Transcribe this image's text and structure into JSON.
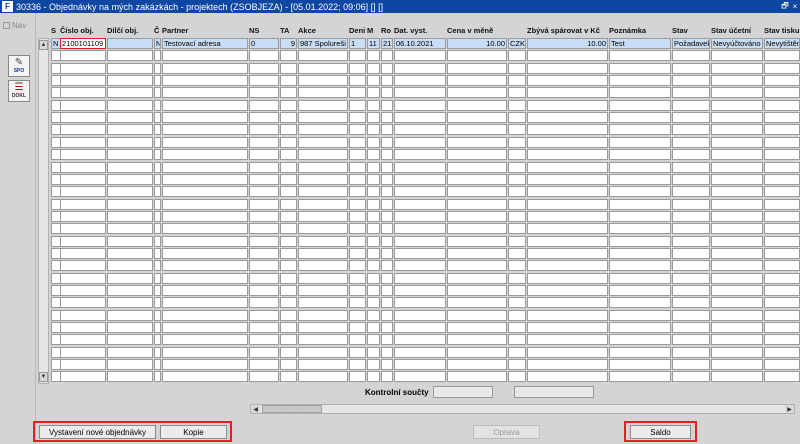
{
  "window": {
    "app_icon": "F",
    "title": "30336 - Objednávky na mých zakázkách - projektech (ZSOBJEZA) - [05.01.2022; 09:06] [] []",
    "restore_glyph": "🗗",
    "close_glyph": "×"
  },
  "sidebar": {
    "nav_label": "Nav",
    "spo_label": "SPO",
    "dokl_label": "DOKL"
  },
  "columns": [
    {
      "key": "s",
      "label": "S"
    },
    {
      "key": "cislo",
      "label": "Číslo obj."
    },
    {
      "key": "dilci",
      "label": "Dílčí obj."
    },
    {
      "key": "c",
      "label": "Č"
    },
    {
      "key": "partner",
      "label": "Partner"
    },
    {
      "key": "ns",
      "label": "NS"
    },
    {
      "key": "ta",
      "label": "TA"
    },
    {
      "key": "akce",
      "label": "Akce"
    },
    {
      "key": "den",
      "label": "Deni"
    },
    {
      "key": "m",
      "label": "M"
    },
    {
      "key": "ro",
      "label": "Ro"
    },
    {
      "key": "dat",
      "label": "Dat. vyst."
    },
    {
      "key": "cena",
      "label": "Cena v měně"
    },
    {
      "key": "mena",
      "label": ""
    },
    {
      "key": "zbyva",
      "label": "Zbývá spárovat v Kč"
    },
    {
      "key": "poznamka",
      "label": "Poznámka"
    },
    {
      "key": "stav",
      "label": "Stav"
    },
    {
      "key": "stav_ucetni",
      "label": "Stav účetní"
    },
    {
      "key": "stav_tisku",
      "label": "Stav tisku"
    }
  ],
  "rows": [
    {
      "s": "N",
      "cislo": "2100101109",
      "dilci": "",
      "c": "N",
      "partner": "Testovací adresa",
      "ns": "0",
      "ta": "9",
      "akce": "987 Spolureši",
      "den": "1",
      "m": "11",
      "ro": "21",
      "dat": "06.10.2021",
      "cena": "10.00",
      "mena": "CZK",
      "zbyva": "10.00",
      "poznamka": "Test",
      "stav": "Požadavek",
      "stav_ucetni": "Nevyúčtováno",
      "stav_tisku": "Nevytištěno"
    }
  ],
  "empty_row_count": 27,
  "footer": {
    "control_sums_label": "Kontrolní součty"
  },
  "buttons": {
    "new_order": "Vystavení nové objednávky",
    "copy": "Kopie",
    "edit": "Oprava",
    "saldo": "Saldo"
  },
  "colors": {
    "title_bar": "#0d47a1",
    "selected_row": "#c9ddf6",
    "highlight_frame": "#e21f26"
  },
  "icons": {
    "scroll_up": "▲",
    "scroll_down": "▼",
    "scroll_left": "◀",
    "scroll_right": "▶",
    "spo": "✎",
    "dokl": "☰"
  }
}
